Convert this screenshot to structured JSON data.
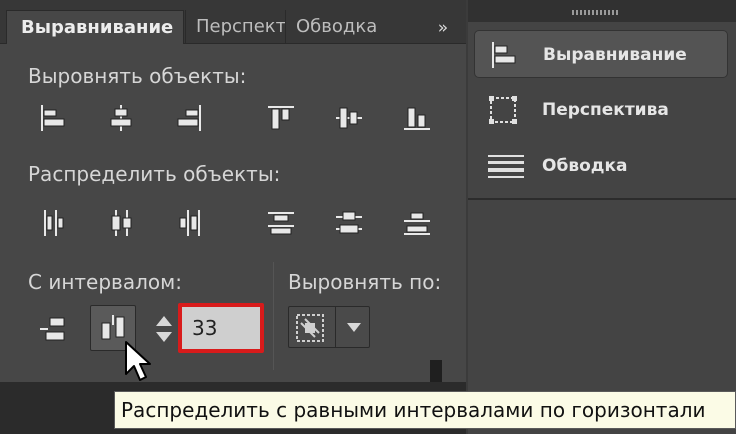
{
  "left_panel": {
    "tabs": [
      {
        "label": "Выравнивание",
        "active": true
      },
      {
        "label": "Перспектива",
        "active": false
      },
      {
        "label": "Обводка",
        "active": false
      }
    ],
    "collapse_label": "»",
    "align_objects_label": "Выровнять объекты:",
    "distribute_objects_label": "Распределить объекты:",
    "spacing_label": "С интервалом:",
    "align_to_label": "Выровнять по:",
    "spacing_value": "33",
    "align_icons": [
      "align-left-edge-icon",
      "align-horizontal-center-icon",
      "align-right-edge-icon",
      "align-top-edge-icon",
      "align-vertical-center-icon",
      "align-bottom-edge-icon"
    ],
    "distribute_icons": [
      "distribute-left-icon",
      "distribute-horizontal-center-icon",
      "distribute-right-icon",
      "distribute-top-icon",
      "distribute-vertical-center-icon",
      "distribute-bottom-icon"
    ]
  },
  "right_panel": {
    "items": [
      {
        "label": "Выравнивание",
        "icon": "align-panel-icon",
        "active": true
      },
      {
        "label": "Перспектива",
        "icon": "perspective-grid-icon",
        "active": false
      },
      {
        "label": "Обводка",
        "icon": "stroke-lines-icon",
        "active": false
      }
    ]
  },
  "tooltip": {
    "text": "Распределить с равными интервалами по горизонтали"
  },
  "colors": {
    "panel_bg": "#474747",
    "highlight_border": "#d81b1b",
    "tooltip_bg": "#fbfbe6"
  }
}
